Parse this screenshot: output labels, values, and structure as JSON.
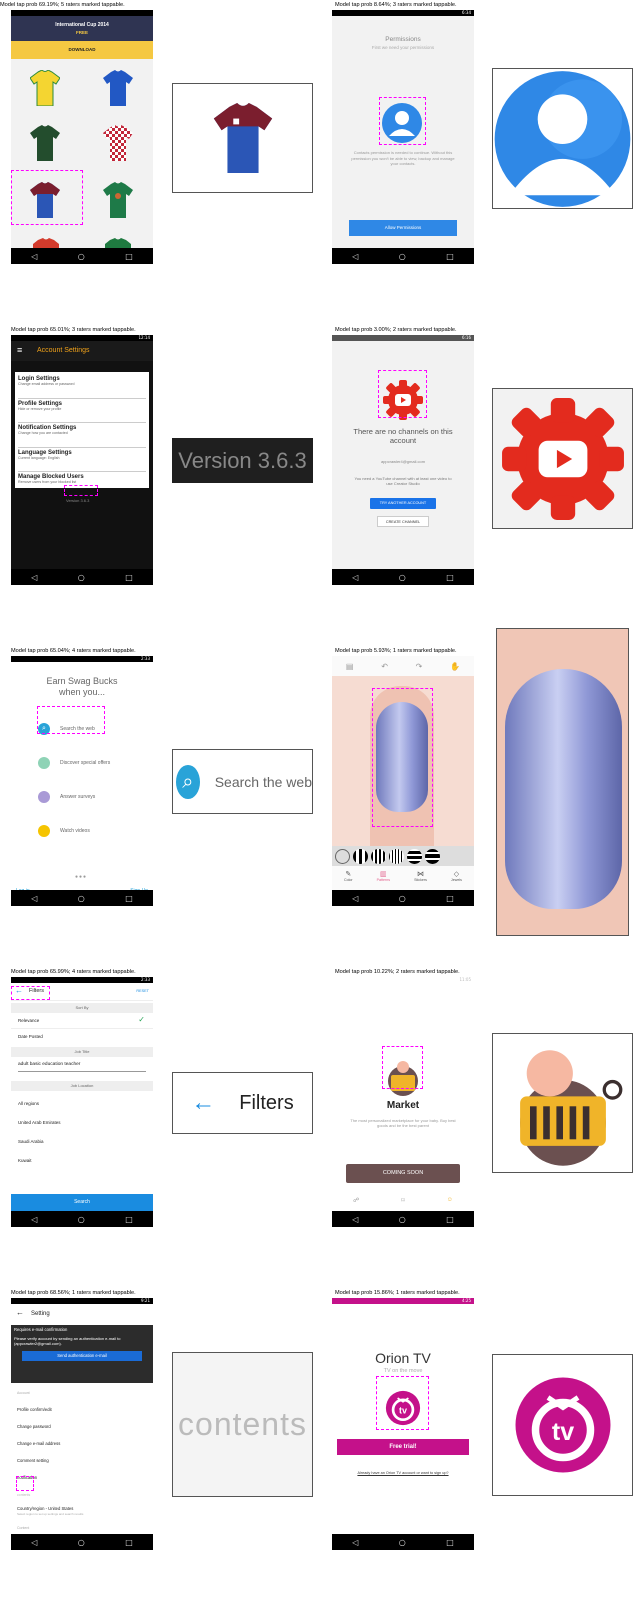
{
  "captions": [
    "Model tap prob 69.19%; 5 raters marked tappable.",
    "Model tap prob 8.64%; 3 raters marked tappable.",
    "Model tap prob 65.01%; 3 raters marked tappable.",
    "Model tap prob 3.00%; 2 raters marked tappable.",
    "Model tap prob 65.04%; 4 raters marked tappable.",
    "Model tap prob 5.93%; 1 raters marked tappable.",
    "Model tap prob 65.99%; 4 raters marked tappable.",
    "Model tap prob 10.22%; 2 raters marked tappable.",
    "Model tap prob 68.56%; 1 raters marked tappable.",
    "Model tap prob 15.86%; 1 raters marked tappable."
  ],
  "status": {
    "p1": "",
    "p2": "6:34",
    "p3": "12:14",
    "p4": "6:16",
    "p5": "2:33",
    "p7": "2:33",
    "p8": "11:05",
    "p9": "9:21",
    "p10": "4:25"
  },
  "jersey": {
    "title": "International Cup 2014",
    "free": "FREE",
    "download": "DOWNLOAD"
  },
  "perm": {
    "title": "Permissions",
    "subtitle": "First we need your permissions",
    "body": "Contacts permission is needed to continue. Without this permission you won't be able to view, backup and manage your contacts.",
    "button": "Allow Permissions"
  },
  "acct": {
    "title": "Account Settings",
    "items": [
      {
        "title": "Login Settings",
        "sub": "Change email address or password"
      },
      {
        "title": "Profile Settings",
        "sub": "Hide or remove your profile"
      },
      {
        "title": "Notification Settings",
        "sub": "Change how you are contacted"
      },
      {
        "title": "Language Settings",
        "sub": "Current language: English"
      },
      {
        "title": "Manage Blocked Users",
        "sub": "Remove users from your blocked list"
      }
    ],
    "version": "Version 3.6.3"
  },
  "yt": {
    "title": "There are no channels on this account",
    "email": "appcrawler4@gmail.com",
    "body": "You need a YouTube channel with at least one video to use Creator Studio",
    "try_btn": "TRY ANOTHER ACCOUNT",
    "create_btn": "CREATE CHANNEL"
  },
  "swag": {
    "title": "Earn Swag Bucks when you...",
    "items": [
      "Search the web",
      "Discover special offers",
      "Answer surveys",
      "Watch videos"
    ],
    "login": "Log in",
    "signup": "Sign Up",
    "zoom": "Search the web"
  },
  "nail": {
    "tabs": [
      "Color",
      "Patterns",
      "Stickers",
      "Jewels"
    ]
  },
  "filters": {
    "title": "Filters",
    "reset": "RESET",
    "sort_by": "Sort By",
    "sort": [
      "Relevance",
      "Date Posted"
    ],
    "job_title_h": "Job Title",
    "job_title": "adult basic education teacher",
    "job_loc_h": "Job Location",
    "locations": [
      "All regions",
      "United Arab Emirates",
      "Saudi Arabia",
      "Kuwait"
    ],
    "search": "Search",
    "zoom": "Filters"
  },
  "market": {
    "title": "Market",
    "body": "The most personalized marketplace for your baby. Buy best goods and be the best parent",
    "button": "COMING SOON"
  },
  "setting": {
    "title": "Setting",
    "req": "Requires e-mail confirmation",
    "req_body": "Please verify account by sending an authentication e-mail to (appcrawler2@gmail.com).",
    "send": "Send authentication e-mail",
    "account_h": "Account",
    "items": [
      "Profile confirm/edit",
      "Change password",
      "Change e-mail address",
      "Comment setting",
      "notification"
    ],
    "contents": "contents",
    "country": "Country/region - United States",
    "country_sub": "Select region to set up settings and search results",
    "content_h": "Content",
    "zoom": "contents"
  },
  "orion": {
    "title": "Orion TV",
    "subtitle": "TV on the move",
    "button": "Free trial!",
    "link": "Already have an Orion TV account or want to sign up?",
    "logo_text": "tv"
  },
  "icons": [
    "back-icon",
    "home-icon",
    "recents-icon",
    "search-icon",
    "menu-icon",
    "check-icon",
    "arrow-back-icon",
    "contact-icon",
    "creator-studio-icon",
    "orion-tv-icon"
  ],
  "colors": {
    "jersey_banner": "#2f3452",
    "jersey_download": "#f5c842",
    "perm_button": "#2f88e6",
    "acct_accent": "#f0a21a",
    "yt_red": "#e32b1e",
    "swag_blue": "#29a3d8",
    "filters_blue": "#1a8ce0",
    "market_button": "#6b5050",
    "setting_header": "#2c2c2c",
    "orion_magenta": "#c4118a"
  }
}
